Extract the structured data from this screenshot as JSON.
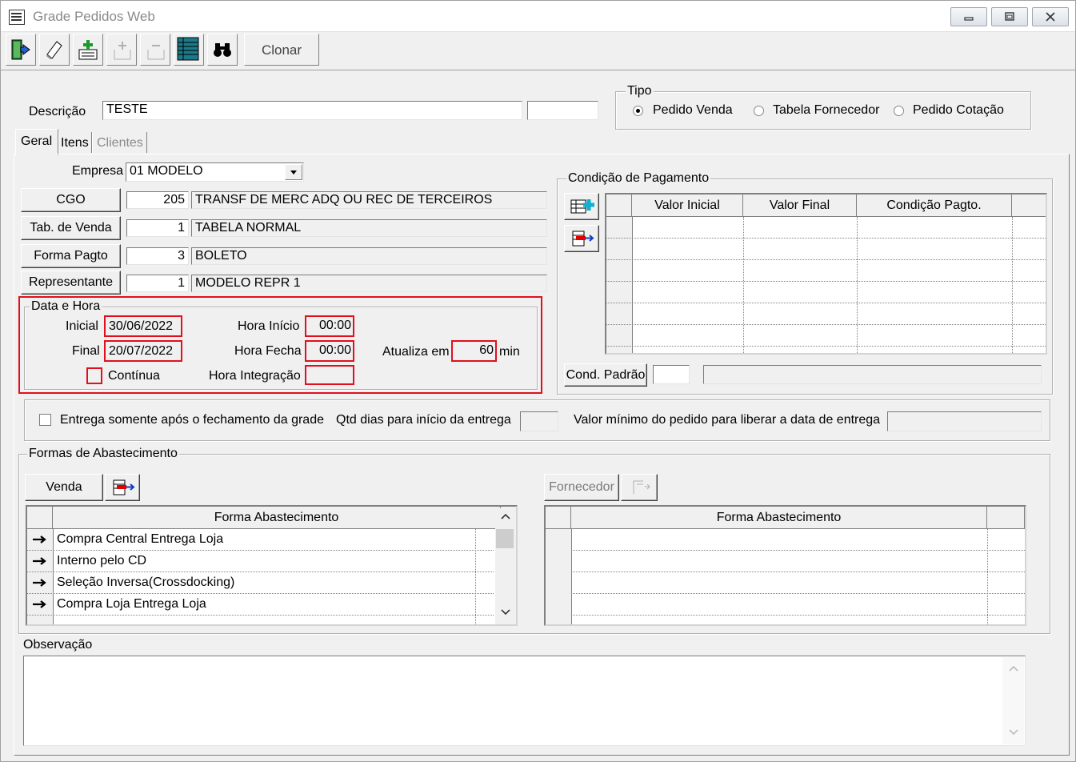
{
  "window": {
    "title": "Grade Pedidos Web",
    "min_label": "▭",
    "max_label": "▢",
    "close_label": "✕"
  },
  "toolbar": {
    "icons": [
      "exit-icon",
      "eraser-icon",
      "add-record-icon",
      "add-disabled-icon",
      "remove-disabled-icon",
      "grid-icon",
      "binoculars-icon"
    ],
    "clonar_label": "Clonar"
  },
  "descricao": {
    "label": "Descrição",
    "value": "TESTE",
    "extra_value": ""
  },
  "tipo": {
    "title": "Tipo",
    "options": [
      "Pedido Venda",
      "Tabela Fornecedor",
      "Pedido Cotação"
    ],
    "selected": "Pedido Venda"
  },
  "tabs": [
    {
      "label": "Geral",
      "active": true
    },
    {
      "label": "Itens",
      "active": false
    },
    {
      "label": "Clientes",
      "active": false
    }
  ],
  "geral": {
    "empresa": {
      "label": "Empresa",
      "value": "01 MODELO"
    },
    "cgo": {
      "button": "CGO",
      "code": "205",
      "desc": "TRANSF DE MERC ADQ OU REC DE TERCEIROS"
    },
    "tab_venda": {
      "button": "Tab. de Venda",
      "code": "1",
      "desc": "TABELA NORMAL"
    },
    "forma_pagto": {
      "button": "Forma Pagto",
      "code": "3",
      "desc": "BOLETO"
    },
    "representante": {
      "button": "Representante",
      "code": "1",
      "desc": "MODELO REPR 1"
    },
    "data_hora": {
      "title": "Data e Hora",
      "inicial_label": "Inicial",
      "inicial": "30/06/2022",
      "final_label": "Final",
      "final": "20/07/2022",
      "hora_inicio_label": "Hora Início",
      "hora_inicio": "00:00",
      "hora_fecha_label": "Hora Fecha",
      "hora_fecha": "00:00",
      "atualiza_label": "Atualiza em",
      "atualiza": "60",
      "min_label": "min",
      "continua_label": "Contínua",
      "continua_checked": false,
      "hora_integracao_label": "Hora Integração",
      "hora_integracao": ""
    },
    "condicao": {
      "title": "Condição de Pagamento",
      "columns": [
        "Valor Inicial",
        "Valor Final",
        "Condição Pagto."
      ],
      "rows": [],
      "cond_padrao_button": "Cond. Padrão",
      "cond_padrao_code": "",
      "cond_padrao_desc": ""
    },
    "entrega": {
      "checkbox_label": "Entrega somente após o fechamento da grade",
      "checked": false,
      "qtd_label": "Qtd dias para início da entrega",
      "qtd_value": "",
      "valor_label": "Valor mínimo do pedido para liberar a data de entrega",
      "valor_value": ""
    },
    "abastecimento": {
      "title": "Formas de Abastecimento",
      "venda_button": "Venda",
      "fornecedor_button": "Fornecedor",
      "left_header": "Forma Abastecimento",
      "left_rows": [
        "Compra Central Entrega Loja",
        "Interno pelo CD",
        "Seleção Inversa(Crossdocking)",
        "Compra Loja Entrega Loja"
      ],
      "right_header": "Forma Abastecimento",
      "right_rows": []
    },
    "observacao": {
      "label": "Observação",
      "value": ""
    }
  },
  "colors": {
    "highlight": "#e0101c",
    "disabled_text": "#8a8a8a",
    "face": "#f0f0f0"
  }
}
